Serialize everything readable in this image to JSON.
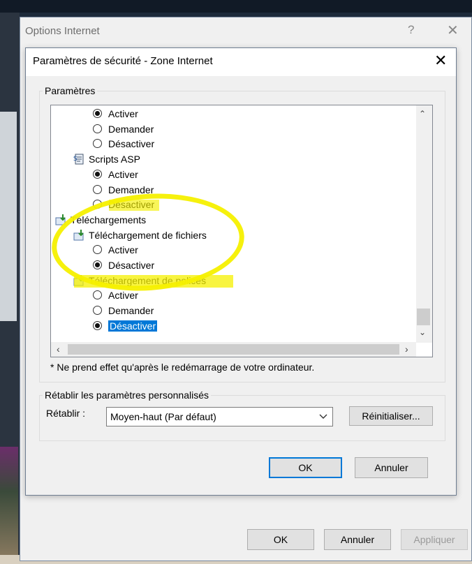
{
  "outer_window": {
    "title": "Options Internet",
    "help": "?",
    "close": "✕",
    "buttons": {
      "ok": "OK",
      "cancel": "Annuler",
      "apply": "Appliquer"
    }
  },
  "dialog": {
    "title": "Paramètres de sécurité - Zone Internet",
    "close": "✕",
    "settings_group": "Paramètres",
    "tree": [
      {
        "type": "radio",
        "label": "Activer",
        "checked": true
      },
      {
        "type": "radio",
        "label": "Demander",
        "checked": false
      },
      {
        "type": "radio",
        "label": "Désactiver",
        "checked": false
      },
      {
        "type": "category",
        "label": "Scripts ASP",
        "icon": "script-icon"
      },
      {
        "type": "radio",
        "label": "Activer",
        "checked": true
      },
      {
        "type": "radio",
        "label": "Demander",
        "checked": false
      },
      {
        "type": "radio",
        "label": "Désactiver",
        "checked": false
      },
      {
        "type": "category",
        "label": "Téléchargements",
        "icon": "download-icon"
      },
      {
        "type": "category",
        "label": "Téléchargement de fichiers",
        "icon": "download-icon"
      },
      {
        "type": "radio",
        "label": "Activer",
        "checked": false
      },
      {
        "type": "radio",
        "label": "Désactiver",
        "checked": true
      },
      {
        "type": "category",
        "label": "Téléchargement de polices",
        "icon": "download-icon"
      },
      {
        "type": "radio",
        "label": "Activer",
        "checked": false
      },
      {
        "type": "radio",
        "label": "Demander",
        "checked": false
      },
      {
        "type": "radio",
        "label": "Désactiver",
        "checked": true,
        "selected": true
      }
    ],
    "note": "* Ne prend effet qu'après le redémarrage de votre ordinateur.",
    "reset_group": "Rétablir les paramètres personnalisés",
    "reset_label": "Rétablir :",
    "reset_value": "Moyen-haut (Par défaut)",
    "reset_button": "Réinitialiser...",
    "ok": "OK",
    "cancel": "Annuler"
  },
  "colors": {
    "highlight": "#f5f000",
    "selection": "#0078d7"
  }
}
